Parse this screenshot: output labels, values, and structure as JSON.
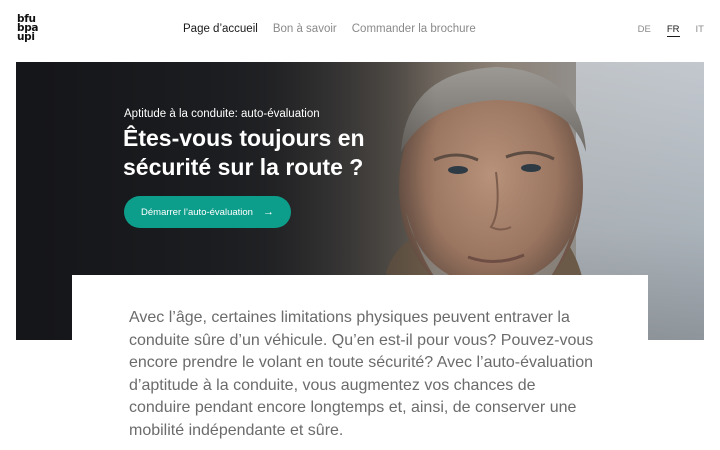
{
  "logo": {
    "lines": [
      "bfu",
      "bpa",
      "upi"
    ]
  },
  "nav": {
    "items": [
      {
        "label": "Page d’accueil",
        "active": true
      },
      {
        "label": "Bon à savoir",
        "active": false
      },
      {
        "label": "Commander la brochure",
        "active": false
      }
    ]
  },
  "lang": {
    "items": [
      {
        "label": "DE",
        "active": false
      },
      {
        "label": "FR",
        "active": true
      },
      {
        "label": "IT",
        "active": false
      }
    ]
  },
  "hero": {
    "eyebrow": "Aptitude à la conduite: auto-évaluation",
    "headline": "Êtes-vous toujours en sécurité sur la route ?",
    "cta_label": "Démarrer l’auto-évaluation",
    "cta_icon": "arrow-right-icon",
    "accent": "#0d9e8b"
  },
  "intro": {
    "text": "Avec l’âge, certaines limitations physiques peuvent entraver la conduite sûre d’un véhicule. Qu’en est-il pour vous? Pouvez-vous encore prendre le volant en toute sécurité? Avec l’auto-évaluation d’aptitude à la conduite, vous augmentez vos chances de conduire pendant encore longtemps et, ainsi, de conserver une mobilité indépendante et sûre."
  }
}
